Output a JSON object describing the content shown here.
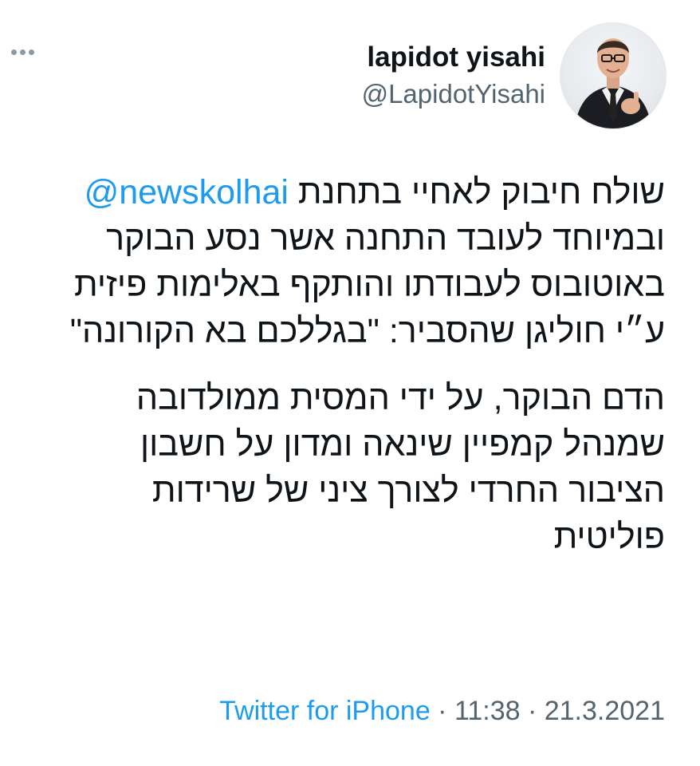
{
  "tweet": {
    "more_icon": "more-horizontal-icon",
    "author": {
      "display_name": "lapidot yisahi",
      "handle": "@LapidotYisahi"
    },
    "paragraph1": {
      "line1_prefix": "שולח חיבוק לאחיי בתחנת ",
      "mention": "@newskolhai",
      "line2": "ובמיוחד לעובד התחנה אשר נסע הבוקר",
      "line3": "באוטובוס לעבודתו והותקף באלימות פיזית",
      "line4": "ע״י חוליגן שהסביר: \"בגללכם בא הקורונה\""
    },
    "paragraph2": {
      "line1": "הדם הבוקר, על ידי המסית ממולדובה",
      "line2": "שמנהל קמפיין שינאה ומדון על חשבון",
      "line3": "הציבור החרדי לצורך ציני של שרידות",
      "line4": "פוליטית"
    },
    "footer": {
      "source": "Twitter for iPhone",
      "separator": " · ",
      "time": "11:38",
      "date": "21.3.2021"
    }
  },
  "colors": {
    "link": "#1d9bf0",
    "text": "#0f1419",
    "secondary": "#536471"
  }
}
